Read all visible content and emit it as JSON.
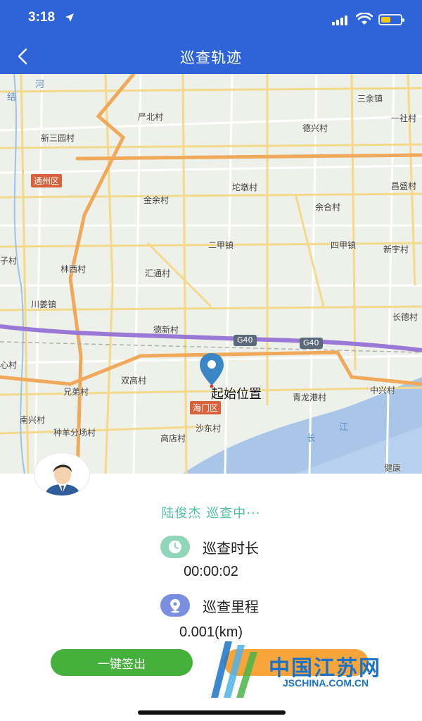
{
  "status_bar": {
    "time": "3:18",
    "battery_level": 0.5,
    "battery_color": "#f5c518"
  },
  "nav": {
    "back_icon": "chevron-left-icon",
    "title": "巡查轨迹",
    "bar_color": "#2f64d8"
  },
  "map": {
    "labels": {
      "yanbei": "严北村",
      "sanyuzhen": "三余镇",
      "yishe": "一社村",
      "xinsanyuan": "新三园村",
      "dexing": "德兴村",
      "tongzhou": "通州区",
      "tuodun": "坨墩村",
      "changsheng": "昌盛村",
      "jinyu": "金余村",
      "yuhe": "余合村",
      "erjia": "二甲镇",
      "sijia": "四甲镇",
      "xinyu": "新宇村",
      "zicun": "子村",
      "linxi": "林西村",
      "huitong": "汇通村",
      "chuanjiang": "川姜镇",
      "changde": "长德村",
      "dexin": "德新村",
      "xincun": "心村",
      "shuanggao": "双高村",
      "xiongdi": "兄弟村",
      "qinglonggang": "青龙港村",
      "zhongxing": "中兴村",
      "haimen": "海门区",
      "nanxing": "南兴村",
      "zhongyang": "种羊分场村",
      "shadong": "沙东村",
      "gaodian": "高店村",
      "jiankang": "健康",
      "he": "河",
      "jie": "结",
      "jiang": "江",
      "chang": "长"
    },
    "highway_1": "G40",
    "highway_2": "G40",
    "start_label": "起始位置",
    "pin_icon": "map-pin-icon",
    "pin_color": "#3b86c6"
  },
  "panel": {
    "avatar_icon": "user-avatar-icon",
    "status_text": "陆俊杰 巡查中···",
    "duration_label": "巡查时长",
    "duration_value": "00:00:02",
    "distance_label": "巡查里程",
    "distance_value": "0.001(km)",
    "clock_icon": "clock-icon",
    "distance_icon": "location-icon",
    "checkout_label": "一键签出",
    "checkout_color": "#46b03c",
    "orange_button_color": "#f7a43a"
  },
  "watermark": {
    "text": "中国江苏网",
    "url": "JSCHINA.COM.CN"
  }
}
